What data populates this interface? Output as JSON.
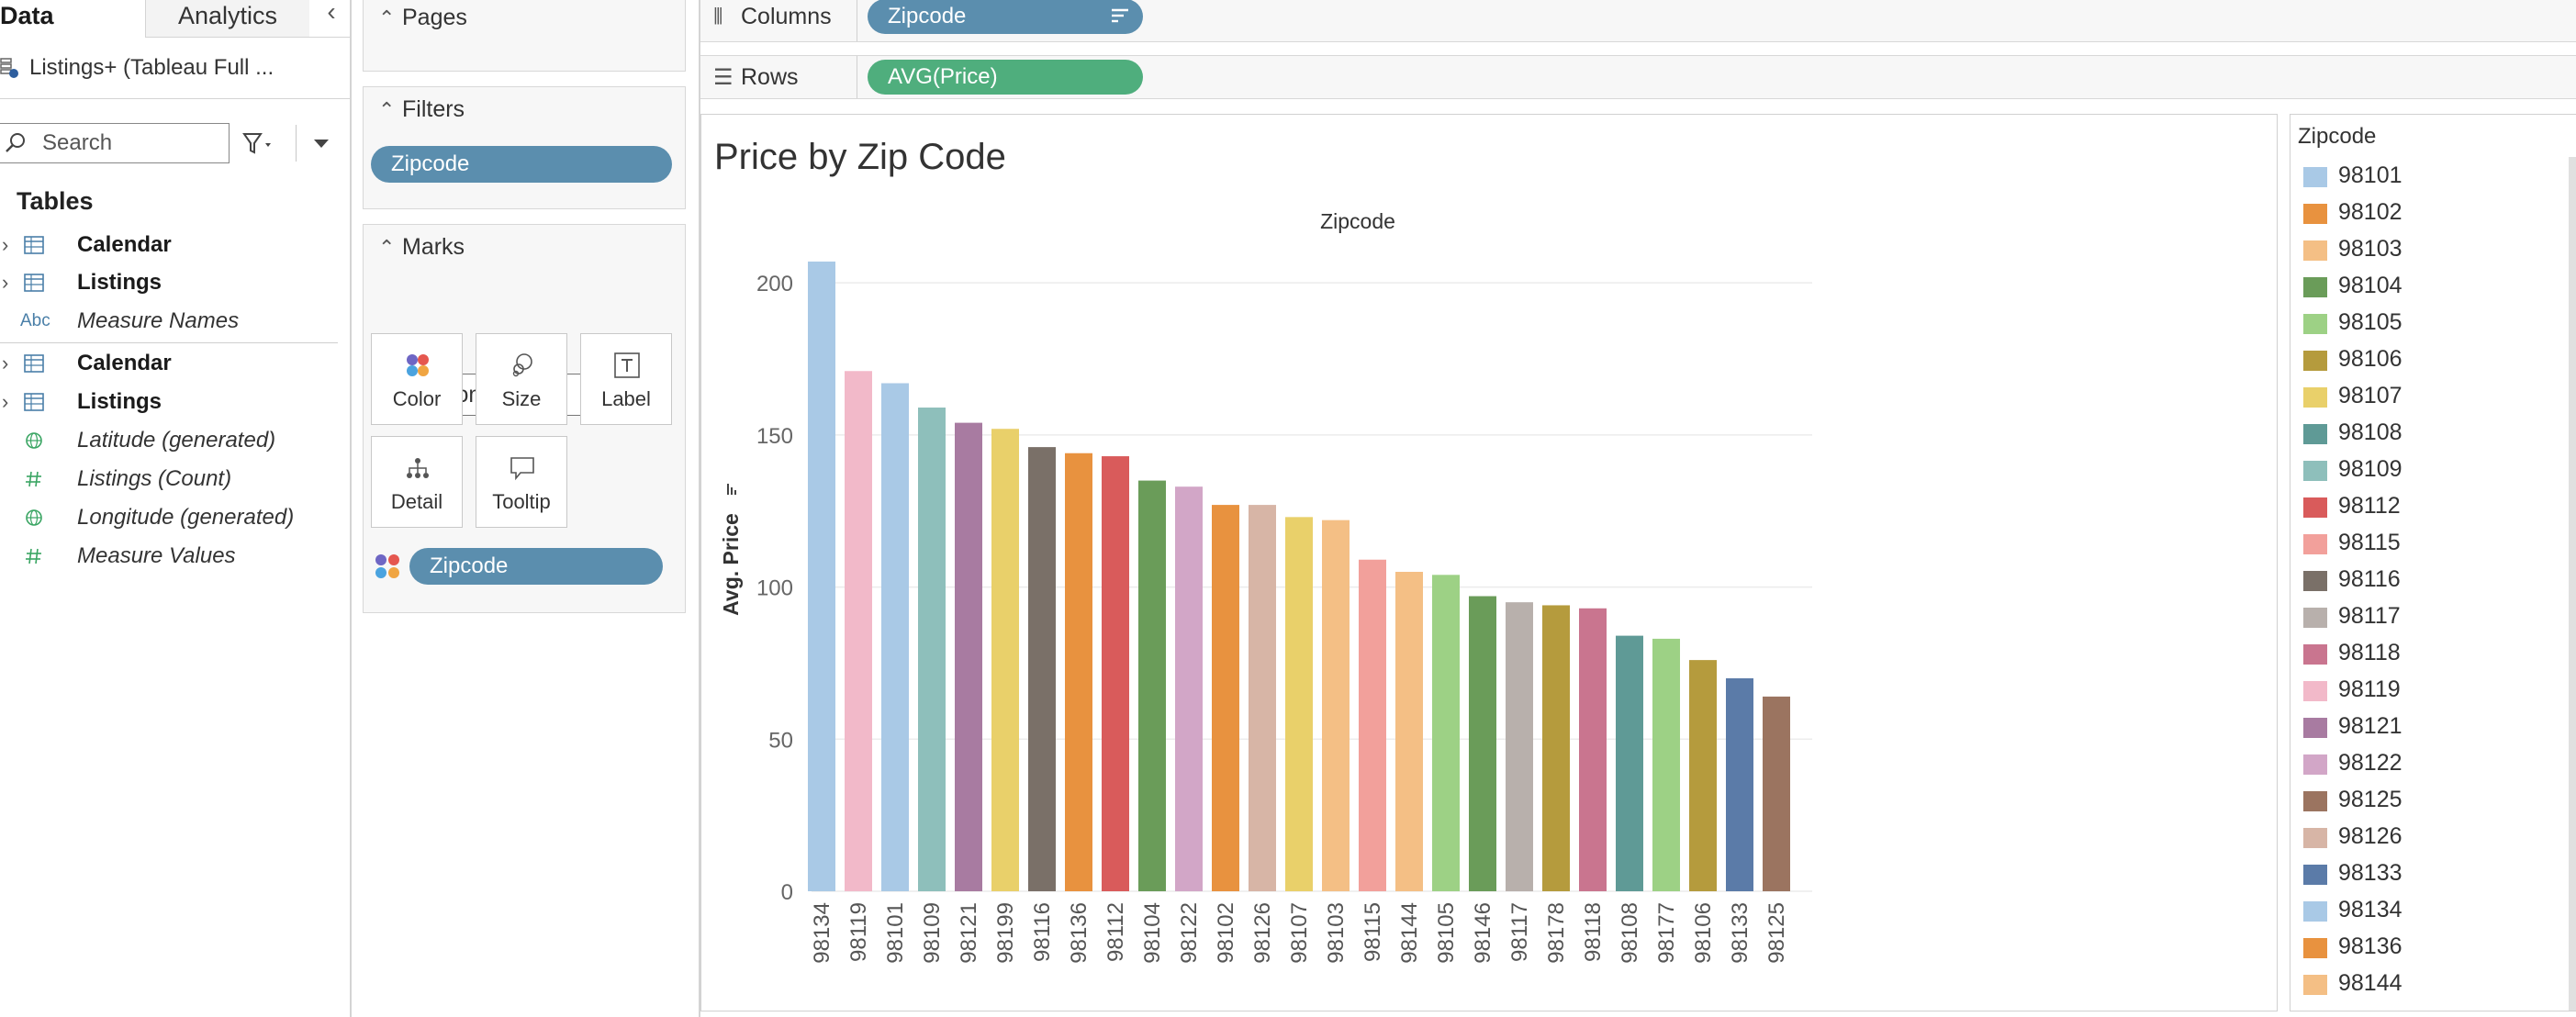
{
  "left_pane": {
    "tabs": [
      "Data",
      "Analytics"
    ],
    "collapse_icon": "chevron-left-icon",
    "datasource": "Listings+ (Tableau Full ...",
    "search_placeholder": "Search",
    "tables_heading": "Tables",
    "fields": [
      {
        "label": "Calendar",
        "style": "bold",
        "icon": "table-icon",
        "expandable": true
      },
      {
        "label": "Listings",
        "style": "bold",
        "icon": "table-icon",
        "expandable": true
      },
      {
        "label": "Measure Names",
        "style": "italic",
        "icon": "abc-icon",
        "icon_text": "Abc",
        "expandable": false
      },
      {
        "label": "Calendar",
        "style": "bold",
        "icon": "table-icon",
        "expandable": true
      },
      {
        "label": "Listings",
        "style": "bold",
        "icon": "table-icon",
        "expandable": true
      },
      {
        "label": "Latitude (generated)",
        "style": "italic",
        "icon": "globe-icon",
        "expandable": false
      },
      {
        "label": "Listings (Count)",
        "style": "italic",
        "icon": "hash-icon",
        "expandable": false
      },
      {
        "label": "Longitude (generated)",
        "style": "italic",
        "icon": "globe-icon",
        "expandable": false
      },
      {
        "label": "Measure Values",
        "style": "italic",
        "icon": "hash-icon",
        "expandable": false
      }
    ]
  },
  "cards": {
    "pages": {
      "title": "Pages"
    },
    "filters": {
      "title": "Filters",
      "pill": "Zipcode"
    },
    "marks": {
      "title": "Marks",
      "mark_type": "Automatic",
      "buttons": [
        "Color",
        "Size",
        "Label",
        "Detail",
        "Tooltip"
      ],
      "color_pill": "Zipcode"
    }
  },
  "shelves": {
    "columns": {
      "label": "Columns",
      "pill": "Zipcode"
    },
    "rows": {
      "label": "Rows",
      "pill": "AVG(Price)"
    }
  },
  "colors": {
    "pill_blue": "#5b8eae",
    "pill_green": "#4fae7d"
  },
  "chart_data": {
    "type": "bar",
    "title": "Price by Zip Code",
    "xlabel": "Zipcode",
    "ylabel": "Avg. Price",
    "ylim": [
      0,
      210
    ],
    "yticks": [
      0,
      50,
      100,
      150,
      200
    ],
    "grid": true,
    "categories": [
      "98134",
      "98119",
      "98101",
      "98109",
      "98121",
      "98199",
      "98116",
      "98136",
      "98112",
      "98104",
      "98122",
      "98102",
      "98126",
      "98107",
      "98103",
      "98115",
      "98144",
      "98105",
      "98146",
      "98117",
      "98178",
      "98118",
      "98108",
      "98177",
      "98106",
      "98133",
      "98125"
    ],
    "values": [
      207,
      171,
      167,
      159,
      154,
      152,
      146,
      144,
      143,
      135,
      133,
      127,
      127,
      123,
      122,
      109,
      105,
      104,
      97,
      95,
      94,
      93,
      84,
      83,
      76,
      70,
      64
    ],
    "colors": [
      "#a9c9e6",
      "#f2b9c9",
      "#a9c9e6",
      "#8ebfbb",
      "#a87ba1",
      "#e9d06a",
      "#7a7068",
      "#e8923f",
      "#d95b5b",
      "#6a9c59",
      "#d2a6c7",
      "#e8923f",
      "#d7b5a6",
      "#e9d06a",
      "#f4bf85",
      "#f2a09b",
      "#f4bf85",
      "#9dd185",
      "#6a9c59",
      "#b8b0ac",
      "#b59b3d",
      "#c9758f",
      "#5f9a96",
      "#9dd185",
      "#b59b3d",
      "#5b7ba8",
      "#9b7460"
    ]
  },
  "legend": {
    "title": "Zipcode",
    "items": [
      {
        "label": "98101",
        "color": "#a9c9e6"
      },
      {
        "label": "98102",
        "color": "#e8923f"
      },
      {
        "label": "98103",
        "color": "#f4bf85"
      },
      {
        "label": "98104",
        "color": "#6a9c59"
      },
      {
        "label": "98105",
        "color": "#9dd185"
      },
      {
        "label": "98106",
        "color": "#b59b3d"
      },
      {
        "label": "98107",
        "color": "#e9d06a"
      },
      {
        "label": "98108",
        "color": "#5f9a96"
      },
      {
        "label": "98109",
        "color": "#8ebfbb"
      },
      {
        "label": "98112",
        "color": "#d95b5b"
      },
      {
        "label": "98115",
        "color": "#f2a09b"
      },
      {
        "label": "98116",
        "color": "#7a7068"
      },
      {
        "label": "98117",
        "color": "#b8b0ac"
      },
      {
        "label": "98118",
        "color": "#c9758f"
      },
      {
        "label": "98119",
        "color": "#f2b9c9"
      },
      {
        "label": "98121",
        "color": "#a87ba1"
      },
      {
        "label": "98122",
        "color": "#d2a6c7"
      },
      {
        "label": "98125",
        "color": "#9b7460"
      },
      {
        "label": "98126",
        "color": "#d7b5a6"
      },
      {
        "label": "98133",
        "color": "#5b7ba8"
      },
      {
        "label": "98134",
        "color": "#a9c9e6"
      },
      {
        "label": "98136",
        "color": "#e8923f"
      },
      {
        "label": "98144",
        "color": "#f4bf85"
      }
    ]
  }
}
